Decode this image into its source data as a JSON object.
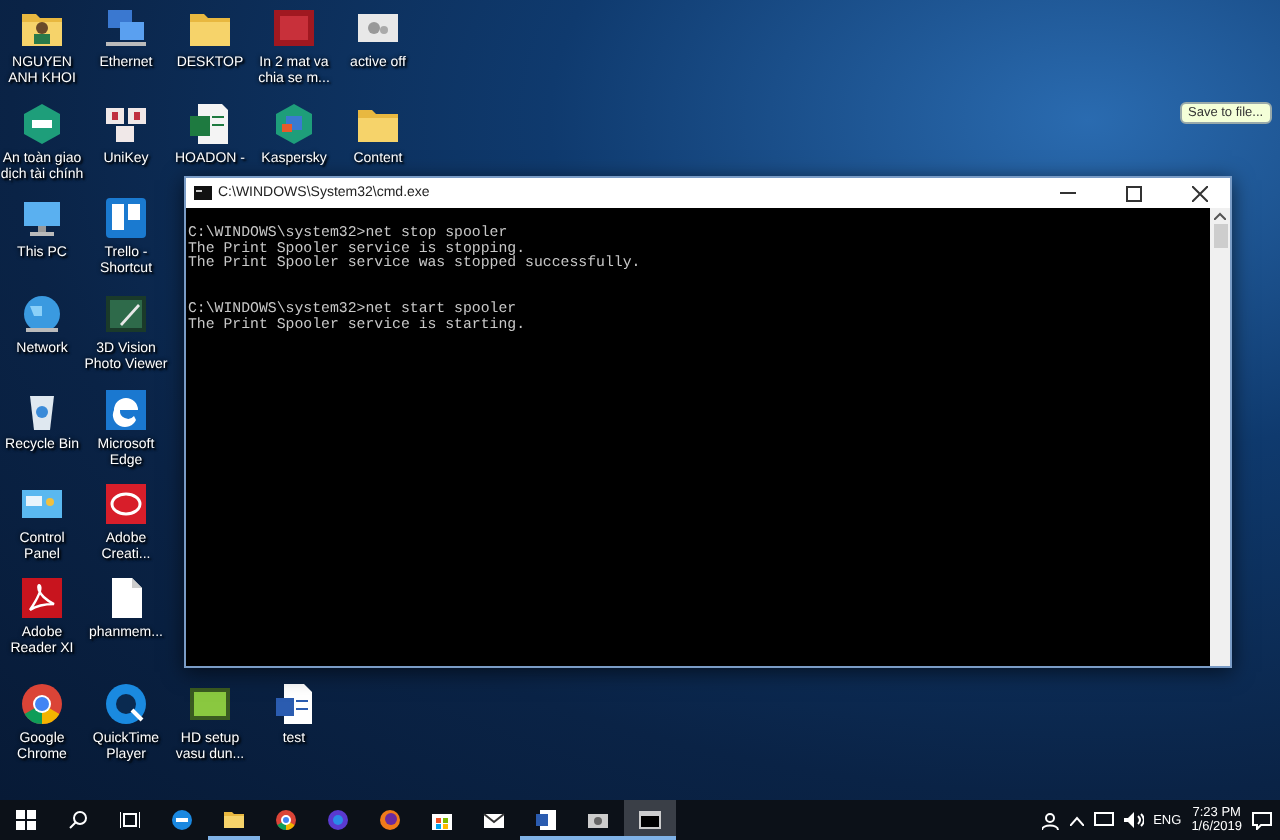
{
  "desktop_icons": [
    {
      "label": "NGUYEN ANH KHOI"
    },
    {
      "label": "Ethernet"
    },
    {
      "label": "DESKTOP"
    },
    {
      "label": "In 2 mat va chia se m..."
    },
    {
      "label": "active off"
    },
    {
      "label": "An toàn giao dịch tài chính"
    },
    {
      "label": "UniKey"
    },
    {
      "label": "HOADON -"
    },
    {
      "label": "Kaspersky"
    },
    {
      "label": "Content"
    },
    {
      "label": "This PC"
    },
    {
      "label": "Trello - Shortcut"
    },
    {
      "label": "Network"
    },
    {
      "label": "3D Vision Photo Viewer"
    },
    {
      "label": "Recycle Bin"
    },
    {
      "label": "Microsoft Edge"
    },
    {
      "label": "Control Panel"
    },
    {
      "label": "Adobe Creati..."
    },
    {
      "label": "Adobe Reader XI"
    },
    {
      "label": "phanmem..."
    },
    {
      "label": "Google Chrome"
    },
    {
      "label": "QuickTime Player"
    },
    {
      "label": "HD setup vasu dun..."
    },
    {
      "label": "test"
    }
  ],
  "tooltip": "Save to file...",
  "console": {
    "title": "C:\\WINDOWS\\System32\\cmd.exe",
    "blocks": [
      {
        "command": "C:\\WINDOWS\\system32>net stop spooler",
        "output": [
          "The Print Spooler service is stopping.",
          "The Print Spooler service was stopped successfully."
        ]
      },
      {
        "command": "C:\\WINDOWS\\system32>net start spooler",
        "output": [
          "The Print Spooler service is starting."
        ]
      }
    ]
  },
  "taskbar": {
    "apps": [
      {
        "running": false,
        "selected": false
      },
      {
        "running": true,
        "selected": false
      },
      {
        "running": false,
        "selected": false
      },
      {
        "running": false,
        "selected": false
      },
      {
        "running": false,
        "selected": false
      },
      {
        "running": false,
        "selected": false
      },
      {
        "running": false,
        "selected": false
      },
      {
        "running": true,
        "selected": false
      },
      {
        "running": true,
        "selected": false
      },
      {
        "running": true,
        "selected": true
      }
    ],
    "language": "ENG",
    "time": "7:23 PM",
    "date": "1/6/2019"
  }
}
